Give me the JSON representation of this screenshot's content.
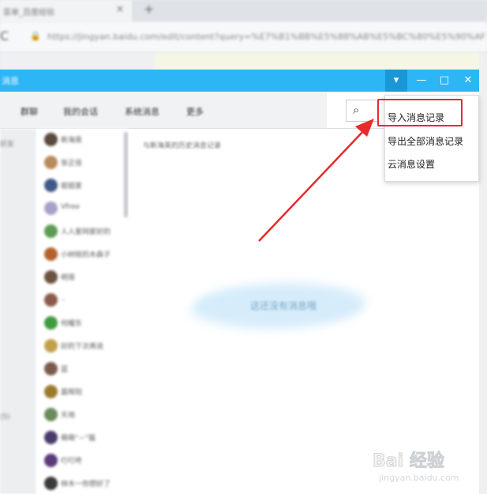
{
  "browser": {
    "tab_title": "菜单_百度经验",
    "tab_close": "×",
    "new_tab": "+",
    "reload": "C",
    "lock": "🔒",
    "url": "https://jingyan.baidu.com/edit/content?query=%E7%B1%BB%E5%88%AB%E5%BC%80%E5%90%AF"
  },
  "app": {
    "title": "消息",
    "controls": {
      "dropdown": "▾",
      "minimize": "—",
      "maximize": "□",
      "close": "✕"
    },
    "tabs": [
      "群聊",
      "我的会话",
      "系统消息",
      "更多"
    ],
    "search_icon": "⌕",
    "left_col": [
      "好友",
      "(5)"
    ],
    "contacts": [
      {
        "name": "新海英",
        "color": "#5a4a3c"
      },
      {
        "name": "张正佳",
        "color": "#b98a5a"
      },
      {
        "name": "姐姐家",
        "color": "#3f5a86"
      },
      {
        "name": "Vfree",
        "color": "#a8a1c8"
      },
      {
        "name": "人人家网家好的",
        "color": "#5d9b54"
      },
      {
        "name": "小树枝的木森子",
        "color": "#b4612b"
      },
      {
        "name": "明哥",
        "color": "#6a5240"
      },
      {
        "name": "..",
        "color": "#8b5a4a"
      },
      {
        "name": "何耀东",
        "color": "#3f9b3e"
      },
      {
        "name": "好的下次再说",
        "color": "#c2a04a"
      },
      {
        "name": "蓝",
        "color": "#7a5a4a"
      },
      {
        "name": "晨晖阳",
        "color": "#9b7b2a"
      },
      {
        "name": "天地",
        "color": "#6b8a5a"
      },
      {
        "name": "萌萌“~”猫",
        "color": "#4a3a6a"
      },
      {
        "name": "叮叮咚",
        "color": "#5a3a7a"
      },
      {
        "name": "林木一你想好了",
        "color": "#3a3a3a"
      }
    ],
    "history_heading": "与新海英的历史消息记录",
    "empty_text": "这还没有消息哦"
  },
  "menu": {
    "items": [
      "导入消息记录",
      "导出全部消息记录",
      "云消息设置"
    ]
  },
  "watermark": {
    "logo": "Bai 经验",
    "url": "jingyan.baidu.com"
  },
  "colors": {
    "titlebar": "#2db6f5",
    "highlight": "#e82a2a",
    "arrow": "#e82a2a"
  }
}
